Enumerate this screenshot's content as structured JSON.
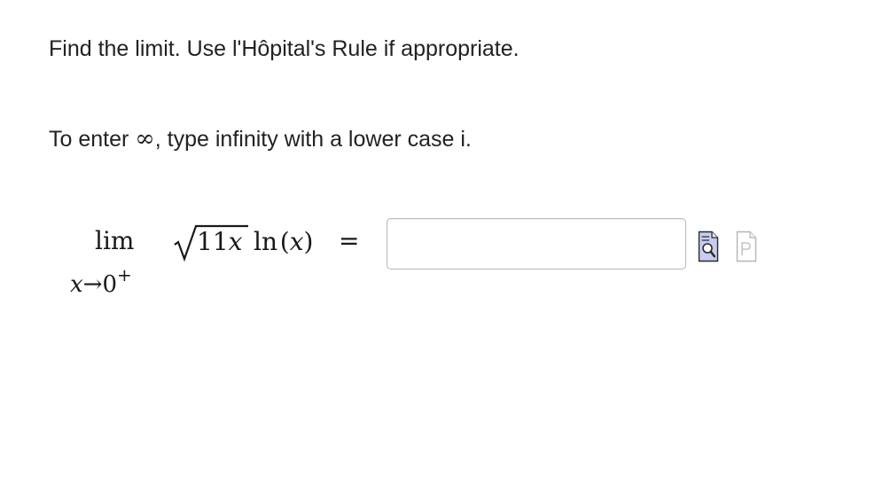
{
  "problem": {
    "instruction": "Find the limit. Use l'Hôpital's Rule if appropriate.",
    "infinity_note": {
      "before": "To enter ",
      "symbol": "∞",
      "after": ", type infinity with a lower case i."
    },
    "expression": {
      "lim": "lim",
      "approach_var": "x",
      "approach_arrow": "→",
      "approach_value": "0",
      "approach_side": "+",
      "radicand_coefficient": "11",
      "radicand_var": "x",
      "function_name": "ln",
      "open_paren": "(",
      "function_arg": "x",
      "close_paren": ")",
      "equals": "="
    },
    "answer": {
      "value": "",
      "placeholder": ""
    },
    "tools": [
      {
        "name": "preview-icon"
      },
      {
        "name": "format-icon"
      }
    ]
  }
}
